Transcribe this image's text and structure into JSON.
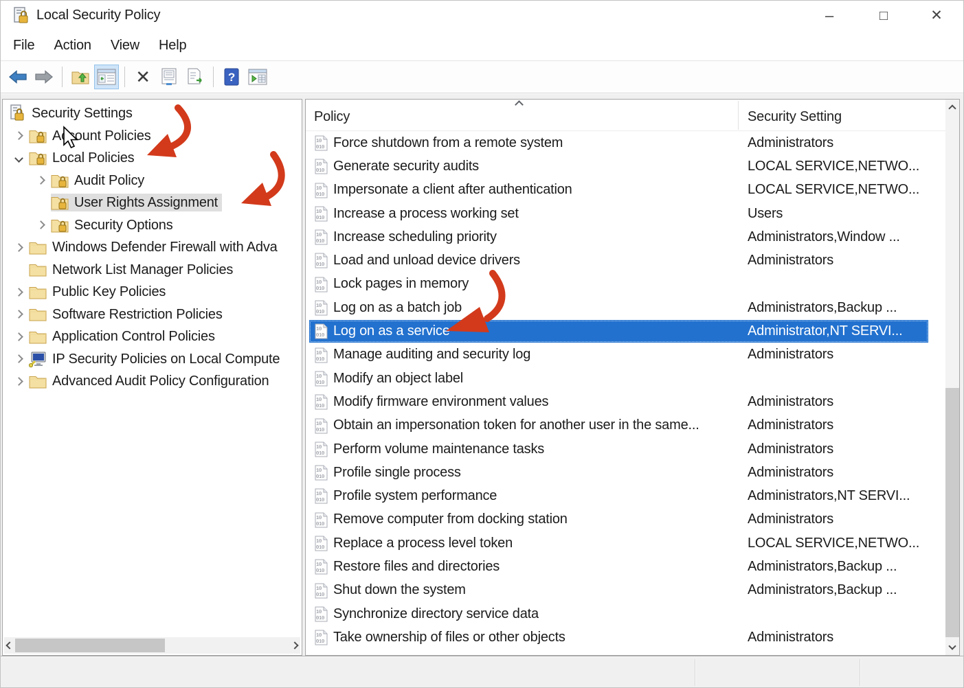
{
  "window": {
    "title": "Local Security Policy",
    "controls": {
      "minimize": "–",
      "maximize": "□",
      "close": "✕"
    }
  },
  "menu": {
    "items": [
      "File",
      "Action",
      "View",
      "Help"
    ]
  },
  "toolbar": {
    "buttons": [
      "back",
      "forward",
      "sep",
      "up-one-level",
      "show-console-tree",
      "sep",
      "delete",
      "properties",
      "export-list",
      "sep",
      "help",
      "show-action-pane"
    ],
    "active_button": "show-console-tree"
  },
  "tree": {
    "items": [
      {
        "label": "Security Settings",
        "level": 0,
        "expander": "none",
        "icon": "server-lock",
        "selected": false
      },
      {
        "label": "Account Policies",
        "level": 1,
        "expander": "collapsed",
        "icon": "folder-lock",
        "selected": false
      },
      {
        "label": "Local Policies",
        "level": 1,
        "expander": "expanded",
        "icon": "folder-lock",
        "selected": false
      },
      {
        "label": "Audit Policy",
        "level": 2,
        "expander": "collapsed",
        "icon": "folder-lock",
        "selected": false
      },
      {
        "label": "User Rights Assignment",
        "level": 2,
        "expander": "none",
        "icon": "folder-lock",
        "selected": true
      },
      {
        "label": "Security Options",
        "level": 2,
        "expander": "collapsed",
        "icon": "folder-lock",
        "selected": false
      },
      {
        "label": "Windows Defender Firewall with Adva",
        "level": 1,
        "expander": "collapsed",
        "icon": "folder",
        "selected": false
      },
      {
        "label": "Network List Manager Policies",
        "level": 1,
        "expander": "none",
        "icon": "folder",
        "selected": false
      },
      {
        "label": "Public Key Policies",
        "level": 1,
        "expander": "collapsed",
        "icon": "folder",
        "selected": false
      },
      {
        "label": "Software Restriction Policies",
        "level": 1,
        "expander": "collapsed",
        "icon": "folder",
        "selected": false
      },
      {
        "label": "Application Control Policies",
        "level": 1,
        "expander": "collapsed",
        "icon": "folder",
        "selected": false
      },
      {
        "label": "IP Security Policies on Local Compute",
        "level": 1,
        "expander": "collapsed",
        "icon": "monitor-key",
        "selected": false
      },
      {
        "label": "Advanced Audit Policy Configuration",
        "level": 1,
        "expander": "collapsed",
        "icon": "folder",
        "selected": false
      }
    ]
  },
  "list": {
    "columns": {
      "policy": "Policy",
      "setting": "Security Setting"
    },
    "sort": "ascending",
    "rows": [
      {
        "policy": "Force shutdown from a remote system",
        "setting": "Administrators",
        "selected": false
      },
      {
        "policy": "Generate security audits",
        "setting": "LOCAL SERVICE,NETWO...",
        "selected": false
      },
      {
        "policy": "Impersonate a client after authentication",
        "setting": "LOCAL SERVICE,NETWO...",
        "selected": false
      },
      {
        "policy": "Increase a process working set",
        "setting": "Users",
        "selected": false
      },
      {
        "policy": "Increase scheduling priority",
        "setting": "Administrators,Window ...",
        "selected": false
      },
      {
        "policy": "Load and unload device drivers",
        "setting": "Administrators",
        "selected": false
      },
      {
        "policy": "Lock pages in memory",
        "setting": "",
        "selected": false
      },
      {
        "policy": "Log on as a batch job",
        "setting": "Administrators,Backup ...",
        "selected": false
      },
      {
        "policy": "Log on as a service",
        "setting": "Administrator,NT SERVI...",
        "selected": true
      },
      {
        "policy": "Manage auditing and security log",
        "setting": "Administrators",
        "selected": false
      },
      {
        "policy": "Modify an object label",
        "setting": "",
        "selected": false
      },
      {
        "policy": "Modify firmware environment values",
        "setting": "Administrators",
        "selected": false
      },
      {
        "policy": "Obtain an impersonation token for another user in the same...",
        "setting": "Administrators",
        "selected": false
      },
      {
        "policy": "Perform volume maintenance tasks",
        "setting": "Administrators",
        "selected": false
      },
      {
        "policy": "Profile single process",
        "setting": "Administrators",
        "selected": false
      },
      {
        "policy": "Profile system performance",
        "setting": "Administrators,NT SERVI...",
        "selected": false
      },
      {
        "policy": "Remove computer from docking station",
        "setting": "Administrators",
        "selected": false
      },
      {
        "policy": "Replace a process level token",
        "setting": "LOCAL SERVICE,NETWO...",
        "selected": false
      },
      {
        "policy": "Restore files and directories",
        "setting": "Administrators,Backup ...",
        "selected": false
      },
      {
        "policy": "Shut down the system",
        "setting": "Administrators,Backup ...",
        "selected": false
      },
      {
        "policy": "Synchronize directory service data",
        "setting": "",
        "selected": false
      },
      {
        "policy": "Take ownership of files or other objects",
        "setting": "Administrators",
        "selected": false
      }
    ]
  },
  "colors": {
    "selection_blue": "#2271cf",
    "tree_selection_gray": "#dfdfdf",
    "annotation_red": "#d23a1b",
    "folder_yellow": "#f5e0a3"
  }
}
